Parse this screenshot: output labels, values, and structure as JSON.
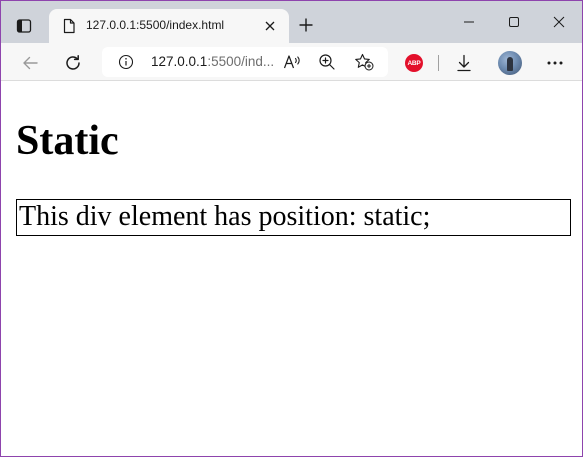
{
  "tab": {
    "title": "127.0.0.1:5500/index.html"
  },
  "address_bar": {
    "url_host": "127.0.0.1",
    "url_rest": ":5500/ind..."
  },
  "page": {
    "heading": "Static",
    "div_text": "This div element has position: static;"
  },
  "toolbar_icons": [
    "back-icon",
    "refresh-icon",
    "info-icon",
    "read-aloud-icon",
    "zoom-icon",
    "favorites-icon",
    "adblock-plus-icon",
    "downloads-icon",
    "profile-avatar",
    "more-icon"
  ],
  "extension": {
    "label": "ABP"
  },
  "colors": {
    "window_border": "#8e44ad",
    "titlebar": "#cfd3da",
    "toolbar": "#f7f7f7",
    "abp_red": "#e3102b"
  }
}
